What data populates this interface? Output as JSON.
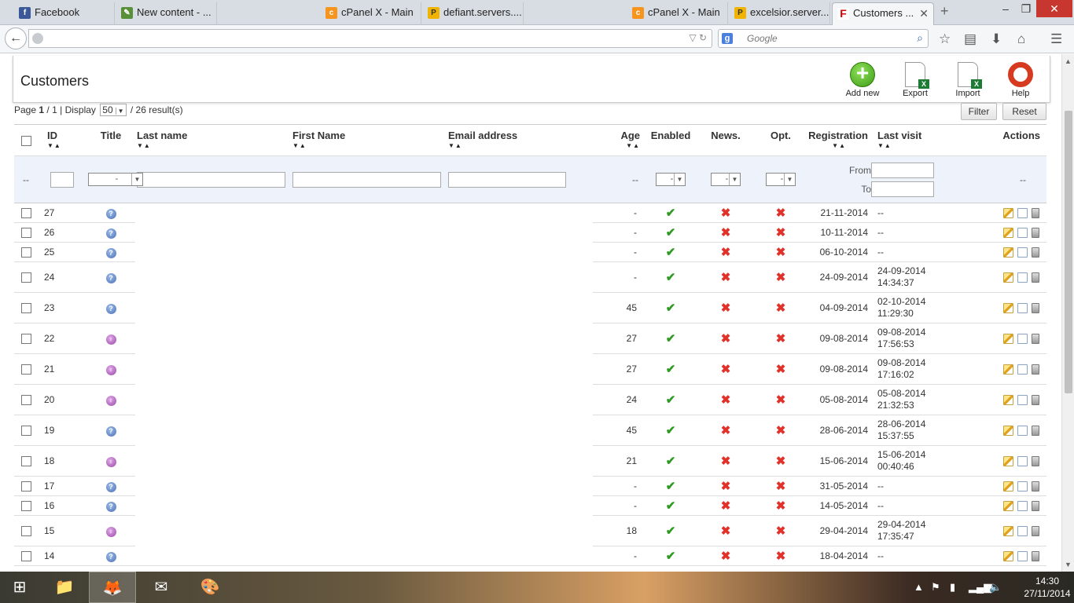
{
  "browser": {
    "tabs": [
      {
        "label": "Facebook",
        "icon": "facebook-favicon"
      },
      {
        "label": "New content - ...",
        "icon": "newcontent-favicon"
      },
      {
        "label": "cPanel X - Main",
        "icon": "cpanel-favicon"
      },
      {
        "label": "defiant.servers....",
        "icon": "phpmyadmin-favicon"
      },
      {
        "label": "cPanel X - Main",
        "icon": "cpanel-favicon"
      },
      {
        "label": "excelsior.server...",
        "icon": "phpmyadmin-favicon"
      },
      {
        "label": "Customers ...",
        "icon": "prestashop-favicon",
        "active": true
      }
    ],
    "new_tab": "+",
    "search_placeholder": "Google",
    "window_controls": {
      "minimize": "–",
      "restore": "❐",
      "close": "✕"
    }
  },
  "page": {
    "title": "Customers",
    "toolbar": {
      "add_new": "Add new",
      "export": "Export",
      "import": "Import",
      "help": "Help"
    },
    "pagination": {
      "page_label": "Page",
      "current_page": "1",
      "total_pages": "1",
      "display_label": "Display",
      "per_page": "50",
      "results_text": "/ 26 result(s)"
    },
    "filter_button": "Filter",
    "reset_button": "Reset"
  },
  "table": {
    "columns": {
      "id": "ID",
      "title": "Title",
      "last_name": "Last name",
      "first_name": "First Name",
      "email": "Email address",
      "age": "Age",
      "enabled": "Enabled",
      "news": "News.",
      "opt": "Opt.",
      "registration": "Registration",
      "last_visit": "Last visit",
      "actions": "Actions"
    },
    "filters": {
      "dash": "--",
      "select_default": "-",
      "from_label": "From",
      "to_label": "To"
    },
    "rows": [
      {
        "id": "27",
        "title": "unknown",
        "age": "-",
        "enabled": true,
        "news": false,
        "opt": false,
        "registration": "21-11-2014",
        "last_visit": [
          "--"
        ]
      },
      {
        "id": "26",
        "title": "unknown",
        "age": "-",
        "enabled": true,
        "news": false,
        "opt": false,
        "registration": "10-11-2014",
        "last_visit": [
          "--"
        ]
      },
      {
        "id": "25",
        "title": "unknown",
        "age": "-",
        "enabled": true,
        "news": false,
        "opt": false,
        "registration": "06-10-2014",
        "last_visit": [
          "--"
        ]
      },
      {
        "id": "24",
        "title": "unknown",
        "age": "-",
        "enabled": true,
        "news": false,
        "opt": false,
        "registration": "24-09-2014",
        "last_visit": [
          "24-09-2014",
          "14:34:37"
        ]
      },
      {
        "id": "23",
        "title": "unknown",
        "age": "45",
        "enabled": true,
        "news": false,
        "opt": false,
        "registration": "04-09-2014",
        "last_visit": [
          "02-10-2014",
          "11:29:30"
        ]
      },
      {
        "id": "22",
        "title": "female",
        "age": "27",
        "enabled": true,
        "news": false,
        "opt": false,
        "registration": "09-08-2014",
        "last_visit": [
          "09-08-2014",
          "17:56:53"
        ]
      },
      {
        "id": "21",
        "title": "female",
        "age": "27",
        "enabled": true,
        "news": false,
        "opt": false,
        "registration": "09-08-2014",
        "last_visit": [
          "09-08-2014",
          "17:16:02"
        ]
      },
      {
        "id": "20",
        "title": "female",
        "age": "24",
        "enabled": true,
        "news": false,
        "opt": false,
        "registration": "05-08-2014",
        "last_visit": [
          "05-08-2014",
          "21:32:53"
        ]
      },
      {
        "id": "19",
        "title": "unknown",
        "age": "45",
        "enabled": true,
        "news": false,
        "opt": false,
        "registration": "28-06-2014",
        "last_visit": [
          "28-06-2014",
          "15:37:55"
        ]
      },
      {
        "id": "18",
        "title": "female",
        "age": "21",
        "enabled": true,
        "news": false,
        "opt": false,
        "registration": "15-06-2014",
        "last_visit": [
          "15-06-2014",
          "00:40:46"
        ]
      },
      {
        "id": "17",
        "title": "unknown",
        "age": "-",
        "enabled": true,
        "news": false,
        "opt": false,
        "registration": "31-05-2014",
        "last_visit": [
          "--"
        ]
      },
      {
        "id": "16",
        "title": "unknown",
        "age": "-",
        "enabled": true,
        "news": false,
        "opt": false,
        "registration": "14-05-2014",
        "last_visit": [
          "--"
        ]
      },
      {
        "id": "15",
        "title": "female",
        "age": "18",
        "enabled": true,
        "news": false,
        "opt": false,
        "registration": "29-04-2014",
        "last_visit": [
          "29-04-2014",
          "17:35:47"
        ]
      },
      {
        "id": "14",
        "title": "unknown",
        "age": "-",
        "enabled": true,
        "news": false,
        "opt": false,
        "registration": "18-04-2014",
        "last_visit": [
          "--"
        ]
      }
    ]
  },
  "taskbar": {
    "apps": [
      "start-button",
      "file-explorer",
      "firefox",
      "outlook",
      "paint"
    ],
    "clock_time": "14:30",
    "clock_date": "27/11/2014"
  },
  "colors": {
    "enabled_check": "#2f9a22",
    "disabled_cross": "#e0322a",
    "filter_row_bg": "#eef3fb"
  }
}
